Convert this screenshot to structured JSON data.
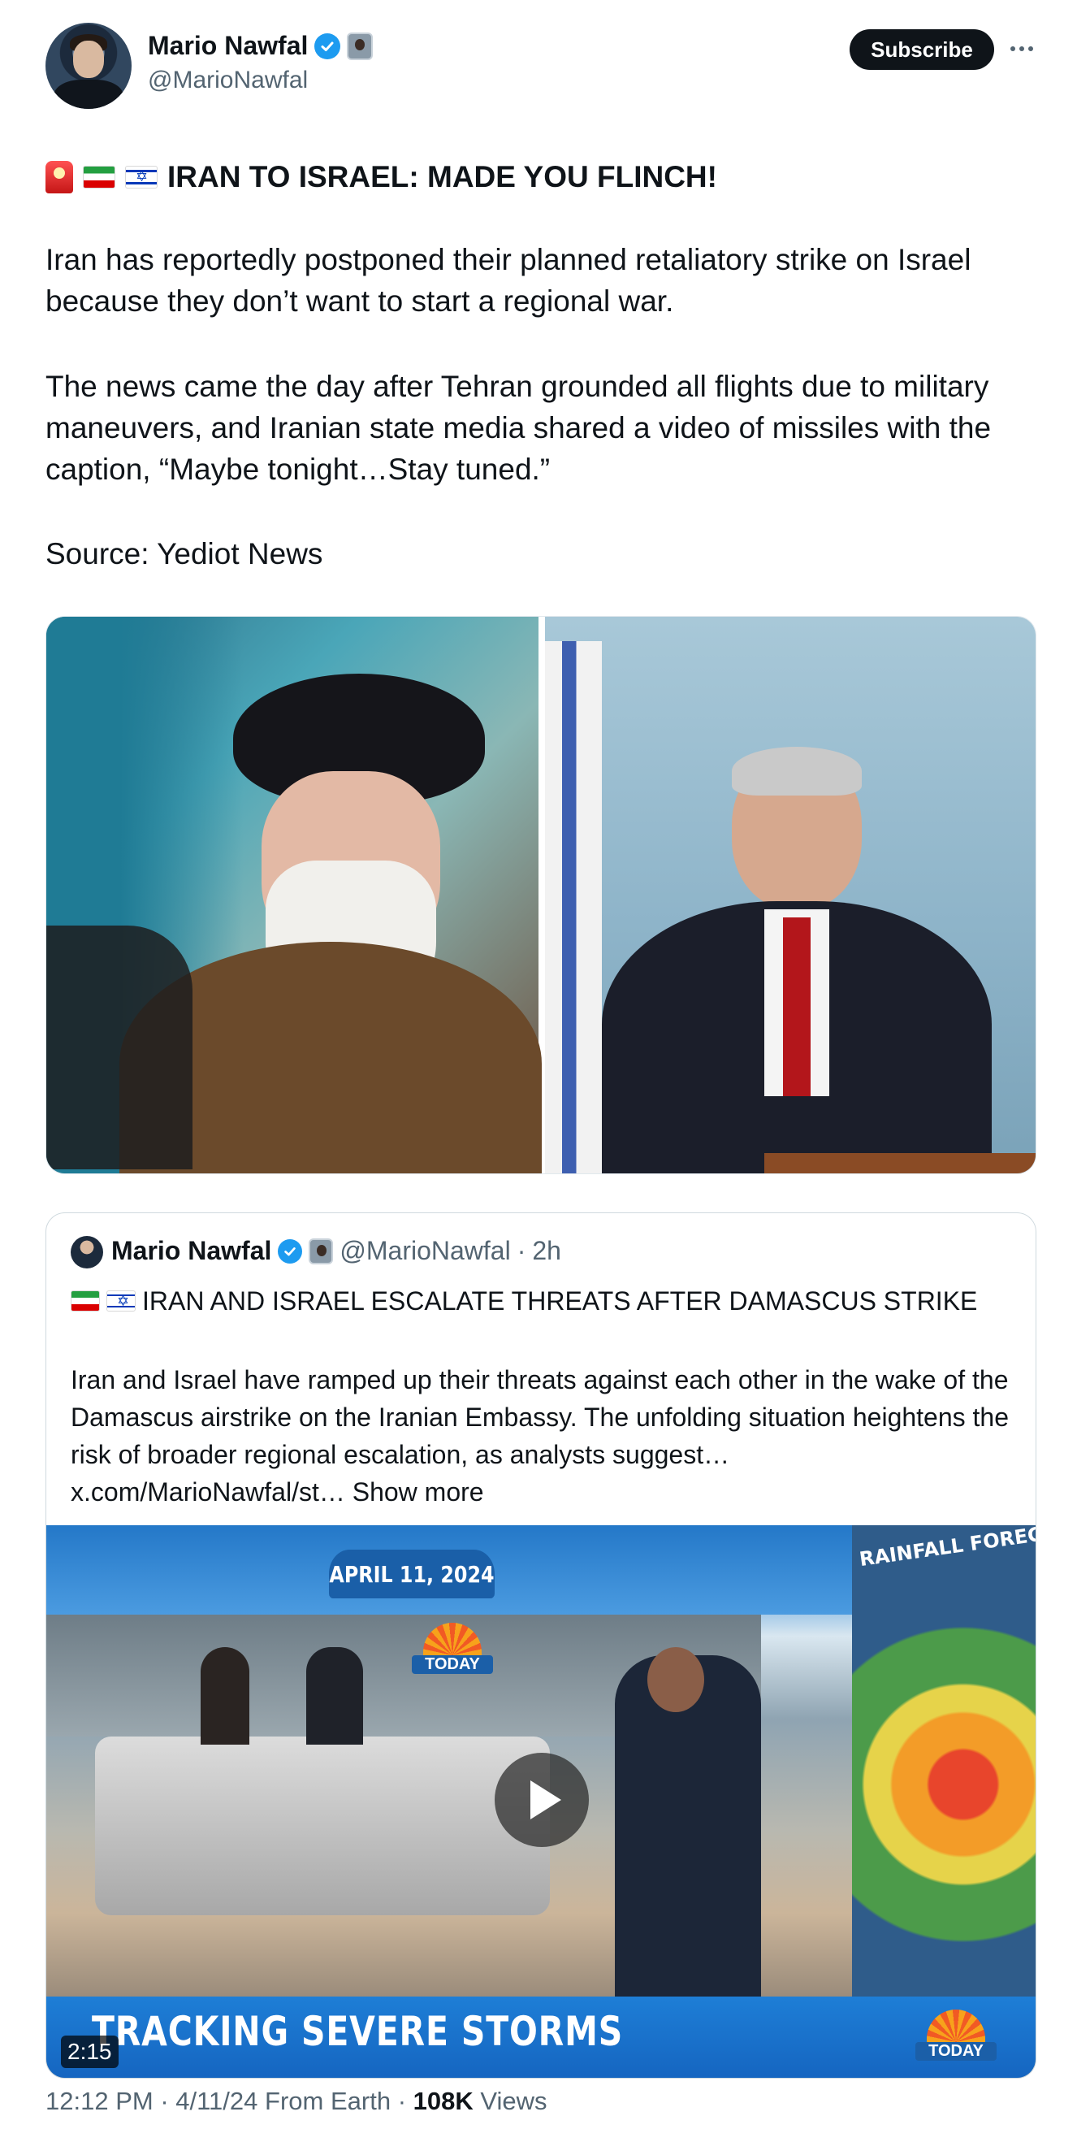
{
  "author": {
    "name": "Mario Nawfal",
    "handle": "@MarioNawfal"
  },
  "actions": {
    "subscribe_label": "Subscribe"
  },
  "tweet": {
    "headline": "IRAN TO ISRAEL: MADE YOU FLINCH!",
    "paragraph1": "Iran has reportedly postponed their planned retaliatory strike on Israel because they don’t want to start a regional war.",
    "paragraph2": "The news came the day after Tehran grounded all flights due to military maneuvers, and Iranian state media shared a video of missiles with the caption, “Maybe tonight…Stay tuned.”",
    "source": "Source: Yediot News"
  },
  "quote": {
    "name": "Mario Nawfal",
    "handle": "@MarioNawfal",
    "time": "2h",
    "title": "IRAN AND ISRAEL ESCALATE THREATS AFTER DAMASCUS STRIKE",
    "body": "Iran and Israel have ramped up their threats against each other in the wake of the Damascus airstrike on the Iranian Embassy. The unfolding situation heightens the risk of broader regional escalation, as analysts suggest…",
    "link": "x.com/MarioNawfal/st…",
    "show_more": "Show more",
    "video": {
      "duration": "2:15",
      "banner": "TRACKING SEVERE STORMS",
      "date_sign": "APRIL 11, 2024",
      "today_logo": "TODAY",
      "map_title": "RAINFALL FORECAS"
    }
  },
  "meta": {
    "time": "12:12 PM",
    "date": "4/11/24",
    "from": "From Earth",
    "views_count": "108K",
    "views_label": "Views"
  },
  "colors": {
    "text": "#0f1419",
    "secondary": "#536471",
    "verified": "#1d9bf0",
    "border": "#cfd9de"
  },
  "icons": [
    "verified-badge-icon",
    "affiliate-badge-icon",
    "more-icon",
    "siren-emoji",
    "iran-flag-emoji",
    "israel-flag-emoji",
    "play-icon"
  ]
}
